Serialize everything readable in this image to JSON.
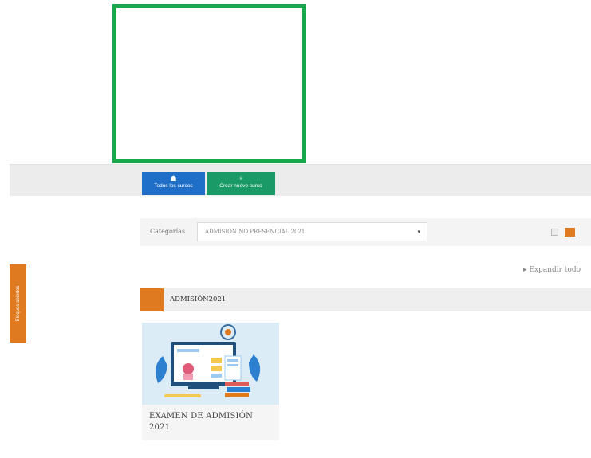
{
  "toolbar": {
    "all_courses_label": "Todos los cursos",
    "new_course_label": "Crear nuevo curso"
  },
  "sidebar": {
    "drawer_label": "Bloques abiertos"
  },
  "categories": {
    "label": "Categorías",
    "selected": "ADMISIÓN NO PRESENCIAL 2021"
  },
  "course_list": {
    "expand_all_label": "Expandir todo",
    "section_title": "ADMISIÓN2021",
    "courses": [
      {
        "name": "EXAMEN DE ADMISIÓN 2021"
      }
    ]
  },
  "colors": {
    "accent": "#e07a20",
    "primary_button": "#1f6fc9",
    "success_button": "#1a9a66",
    "frame": "#18a84c"
  }
}
